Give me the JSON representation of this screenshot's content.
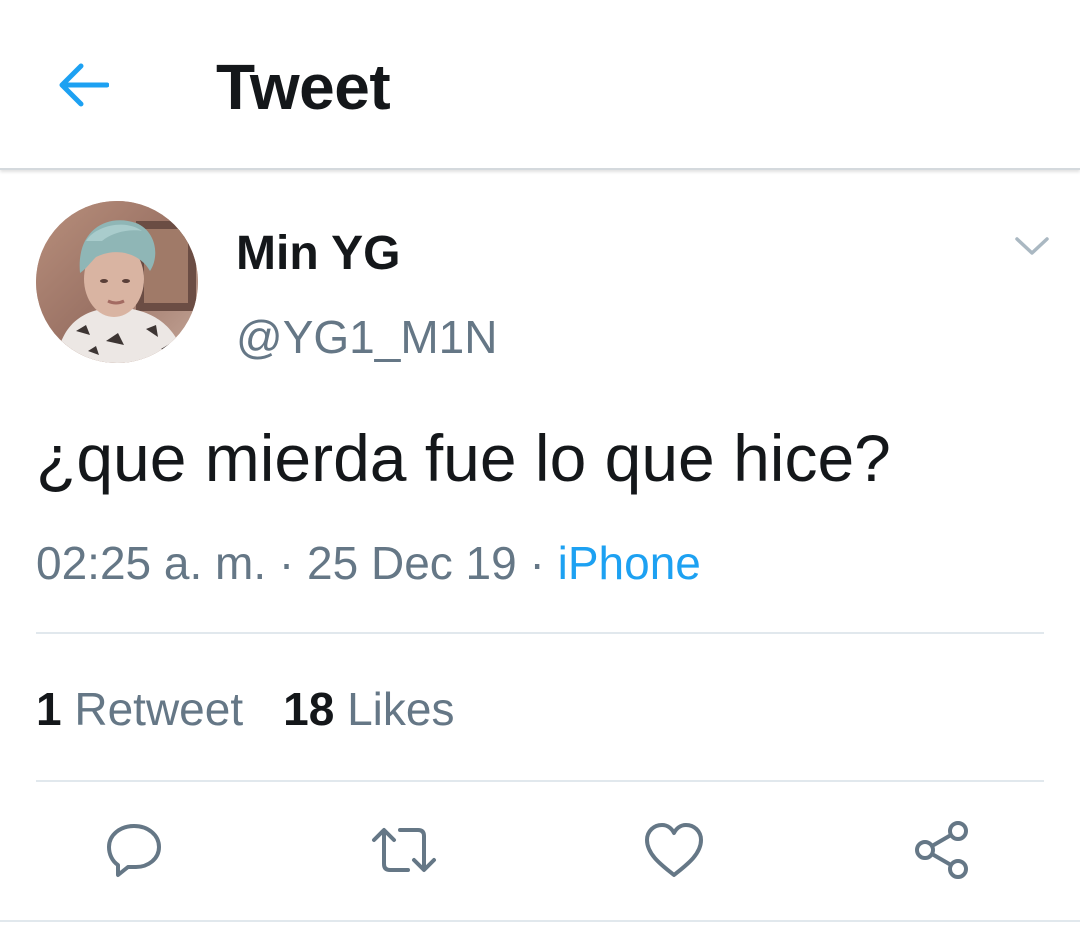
{
  "header": {
    "title": "Tweet",
    "back_icon": "arrow-left-icon"
  },
  "tweet": {
    "author": {
      "display_name": "Min YG",
      "handle": "@YG1_M1N",
      "avatar": "profile-photo"
    },
    "text": "¿que mierda fue lo que hice?",
    "time": "02:25 a. m.",
    "separator": "·",
    "date": "25 Dec 19",
    "source": "iPhone",
    "stats": {
      "retweets_count": "1",
      "retweets_label": "Retweet",
      "likes_count": "18",
      "likes_label": "Likes"
    },
    "actions": [
      "reply-icon",
      "retweet-icon",
      "like-icon",
      "share-icon"
    ]
  },
  "colors": {
    "accent": "#1da1f2",
    "text_primary": "#14171a",
    "text_secondary": "#657786",
    "divider": "#e1e8ed",
    "icon": "#657786"
  }
}
